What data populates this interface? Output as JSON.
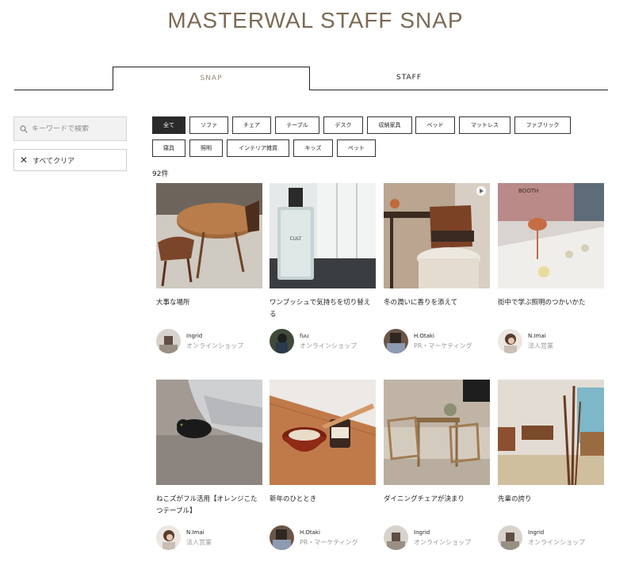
{
  "header": {
    "title": "MASTERWAL STAFF SNAP"
  },
  "tabs": [
    {
      "label": "SNAP"
    },
    {
      "label": "STAFF"
    }
  ],
  "sidebar": {
    "search_placeholder": "キーワードで検索",
    "clear_label": "すべてクリア"
  },
  "filters": [
    "全て",
    "ソファ",
    "チェア",
    "テーブル",
    "デスク",
    "収納家具",
    "ベッド",
    "マットレス",
    "ファブリック",
    "寝具",
    "照明",
    "インテリア雑貨",
    "キッズ",
    "ペット"
  ],
  "active_filter": "全て",
  "result_count": "92件",
  "cards": [
    {
      "title": "大事な場所",
      "author": "Ingrid",
      "dept": "オンラインショップ"
    },
    {
      "title": "ワンプッシュで気持ちを切り替える",
      "author": "fuu",
      "dept": "オンラインショップ"
    },
    {
      "title": "冬の潤いに香りを添えて",
      "author": "H.Otaki",
      "dept": "PR・マーケティング",
      "icon": "play-icon"
    },
    {
      "title": "街中で学ぶ照明のつかいかた",
      "author": "N.Imai",
      "dept": "法人営業"
    },
    {
      "title": "ねこズがフル活用【オレンジこたつテーブル】",
      "author": "N.Imai",
      "dept": "法人営業"
    },
    {
      "title": "新年のひととき",
      "author": "H.Otaki",
      "dept": "PR・マーケティング"
    },
    {
      "title": "ダイニングチェアが決まり",
      "author": "Ingrid",
      "dept": "オンラインショップ"
    },
    {
      "title": "先輩の誇り",
      "author": "Ingrid",
      "dept": "オンラインショップ"
    }
  ],
  "photo_texts": {
    "perfume_label": "CULT",
    "shop_sign": "BOOTH"
  },
  "colors": {
    "title": "#7b6a55",
    "active_tab": "#9b8c78",
    "active_filter_bg": "#2a2a2a"
  }
}
